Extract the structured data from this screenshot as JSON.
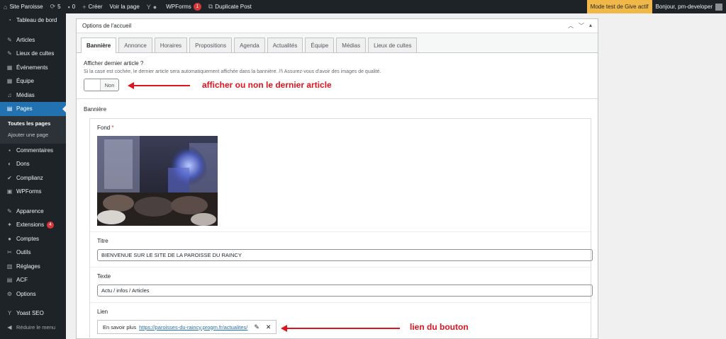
{
  "adminbar": {
    "site": "Site Paroisse",
    "updates": "5",
    "comments": "0",
    "new": "Créer",
    "view": "Voir la page",
    "wpforms": "WPForms",
    "wpforms_count": "1",
    "duplicate": "Duplicate Post",
    "give": "Mode test de Give actif",
    "user": "Bonjour, pm-developer"
  },
  "sidebar": {
    "dashboard": "Tableau de bord",
    "articles": "Articles",
    "lieux": "Lieux de cultes",
    "evenements": "Événements",
    "equipe": "Équipe",
    "medias": "Médias",
    "pages": "Pages",
    "sub_all": "Toutes les pages",
    "sub_add": "Ajouter une page",
    "commentaires": "Commentaires",
    "dons": "Dons",
    "complianz": "Complianz",
    "wpforms": "WPForms",
    "apparence": "Apparence",
    "extensions": "Extensions",
    "extensions_count": "4",
    "comptes": "Comptes",
    "outils": "Outils",
    "reglages": "Réglages",
    "acf": "ACF",
    "options": "Options",
    "yoast": "Yoast SEO",
    "collapse": "Réduire le menu"
  },
  "panel": {
    "title": "Options de l'accueil",
    "tabs": [
      "Bannière",
      "Annonce",
      "Horaires",
      "Propositions",
      "Agenda",
      "Actualités",
      "Équipe",
      "Médias",
      "Lieux de cultes"
    ],
    "afficher_label": "Afficher dernier article ?",
    "afficher_desc": "Si la case est cochée, le dernier article sera automatiquement affichée dans la bannière. /!\\ Assurez-vous d'avoir des images de qualité.",
    "toggle_value": "Non",
    "banniere_title": "Bannière",
    "fond_label": "Fond",
    "required_mark": "*",
    "titre_label": "Titre",
    "titre_value": "BIENVENUE SUR LE SITE DE LA PAROISSE DU RAINCY",
    "texte_label": "Texte",
    "texte_value": "Actu / infos / Articles",
    "lien_label": "Lien",
    "lien_text": "En savoir plus",
    "lien_url": "https://paroisses-du-raincy.progm.fr/actualites/"
  },
  "annotations": {
    "toggle_note": "afficher ou non le dernier article",
    "link_note": "lien du bouton"
  },
  "colors": {
    "accent": "#2271b1",
    "annotation": "#e0141e",
    "admin_dark": "#1d2327"
  }
}
